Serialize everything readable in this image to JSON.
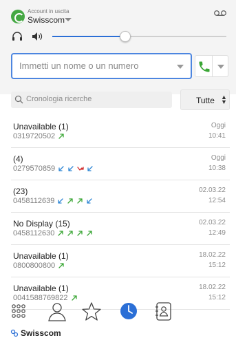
{
  "account": {
    "caption": "Account in uscita",
    "name": "Swisscom"
  },
  "volume": {
    "level": 0.42
  },
  "dial": {
    "placeholder": "Immetti un nome o un numero"
  },
  "search": {
    "placeholder": "Cronologia ricerche",
    "filter_label": "Tutte"
  },
  "colors": {
    "accent": "#2b6fd6",
    "incoming": "#2e86d4",
    "outgoing": "#3aa635",
    "missed": "#d22d2d",
    "call_green": "#3aa635"
  },
  "history": [
    {
      "name": "Unavailable (1)",
      "number": "0319720502",
      "date": "Oggi",
      "time": "10:41",
      "calls": [
        "outgoing"
      ]
    },
    {
      "name": "(4)",
      "number": "0279570859",
      "date": "Oggi",
      "time": "10:38",
      "calls": [
        "incoming",
        "incoming",
        "missed",
        "incoming"
      ]
    },
    {
      "name": "(23)",
      "number": "0458112639",
      "date": "02.03.22",
      "time": "12:54",
      "calls": [
        "incoming",
        "outgoing",
        "outgoing",
        "incoming"
      ]
    },
    {
      "name": "No Display (15)",
      "number": "0458112630",
      "date": "02.03.22",
      "time": "12:49",
      "calls": [
        "outgoing",
        "outgoing",
        "outgoing",
        "outgoing"
      ]
    },
    {
      "name": "Unavailable (1)",
      "number": "0800800800",
      "date": "18.02.22",
      "time": "15:12",
      "calls": [
        "outgoing"
      ]
    },
    {
      "name": "Unavailable (1)",
      "number": "0041588769822",
      "date": "18.02.22",
      "time": "15:12",
      "calls": [
        "outgoing"
      ]
    }
  ],
  "nav": {
    "items": [
      {
        "icon": "dialpad-icon",
        "active": false
      },
      {
        "icon": "contacts-icon",
        "active": false
      },
      {
        "icon": "favorites-star-icon",
        "active": false
      },
      {
        "icon": "history-clock-icon",
        "active": true
      },
      {
        "icon": "address-book-icon",
        "active": false
      }
    ]
  },
  "brand": {
    "name": "Swisscom"
  }
}
